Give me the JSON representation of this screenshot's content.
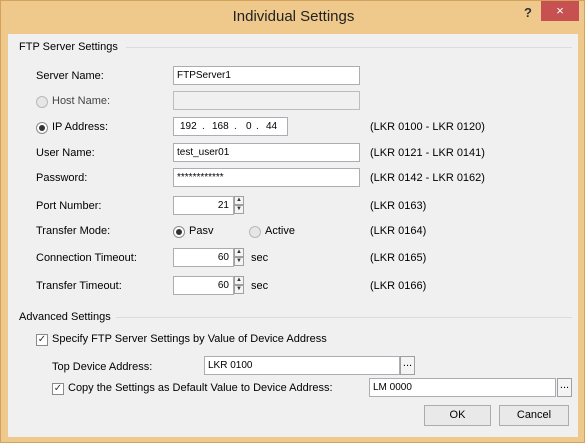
{
  "window": {
    "title": "Individual Settings",
    "help": "?",
    "close": "×"
  },
  "ftp": {
    "section_title": "FTP Server Settings",
    "server_name": {
      "label": "Server Name:",
      "value": "FTPServer1"
    },
    "host_name": {
      "label": "Host Name:",
      "value": ""
    },
    "ip_address": {
      "label": "IP Address:",
      "octets": [
        "192",
        "168",
        "0",
        "44"
      ],
      "range": "(LKR 0100 - LKR 0120)"
    },
    "user_name": {
      "label": "User Name:",
      "value": "test_user01",
      "range": "(LKR 0121 - LKR 0141)"
    },
    "password": {
      "label": "Password:",
      "value": "************",
      "range": "(LKR 0142 - LKR 0162)"
    },
    "port_number": {
      "label": "Port Number:",
      "value": "21",
      "range": "(LKR 0163)"
    },
    "transfer_mode": {
      "label": "Transfer Mode:",
      "options": [
        "Pasv",
        "Active"
      ],
      "selected": "Pasv",
      "range": "(LKR 0164)"
    },
    "connection_timeout": {
      "label": "Connection Timeout:",
      "value": "60",
      "unit": "sec",
      "range": "(LKR 0165)"
    },
    "transfer_timeout": {
      "label": "Transfer Timeout:",
      "value": "60",
      "unit": "sec",
      "range": "(LKR 0166)"
    }
  },
  "advanced": {
    "section_title": "Advanced Settings",
    "specify_check": {
      "label": "Specify FTP Server Settings by Value of Device Address",
      "checked": true
    },
    "top_device_address": {
      "label": "Top Device Address:",
      "value": "LKR 0100",
      "browse": "..."
    },
    "copy_check": {
      "label": "Copy the Settings as Default Value to Device Address:",
      "checked": true,
      "value": "LM 0000",
      "browse": "..."
    }
  },
  "buttons": {
    "ok": "OK",
    "cancel": "Cancel"
  },
  "icons": {
    "radio_on": "radio-selected",
    "spin": "spin-up-down",
    "check": "check-mark"
  }
}
